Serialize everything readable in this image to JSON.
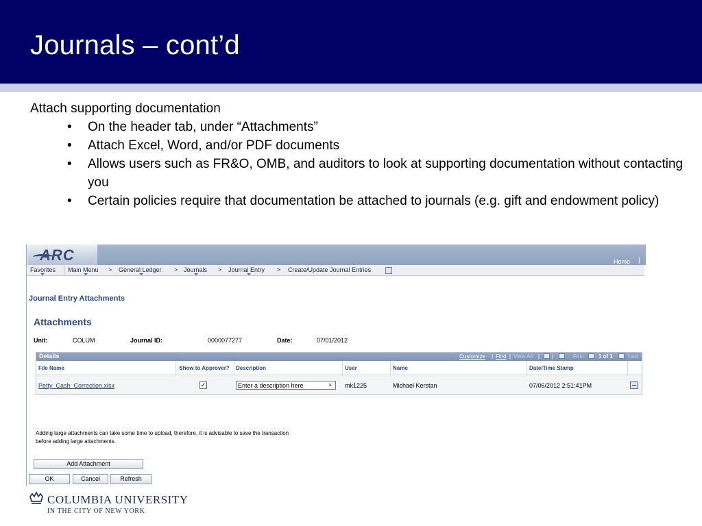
{
  "slide": {
    "title": "Journals – cont’d",
    "intro": "Attach supporting documentation",
    "bullet_char": "•",
    "bullets": [
      "On the header tab, under “Attachments”",
      "Attach Excel, Word, and/or PDF documents",
      "Allows users such as FR&O, OMB, and auditors to look at supporting documentation without contacting you",
      "Certain policies require that documentation be attached to journals (e.g. gift and endowment policy)"
    ]
  },
  "app": {
    "logo": "ARC",
    "home": "Home",
    "home_sep": "|",
    "breadcrumbs": [
      "Favorites",
      "Main Menu",
      "General Ledger",
      "Journals",
      "Journal Entry",
      "Create/Update Journal Entries"
    ],
    "crumb_sep": ">",
    "page_heading": "Journal Entry Attachments",
    "section_heading": "Attachments",
    "info": {
      "unit_label": "Unit:",
      "unit_value": "COLUM",
      "journal_label": "Journal ID:",
      "journal_value": "0000077277",
      "date_label": "Date:",
      "date_value": "07/01/2012"
    },
    "grid": {
      "title": "Details",
      "customize": "Customize",
      "find": "Find",
      "view_all": "View All",
      "sep": "|",
      "first": "First",
      "count": "1 of 1",
      "last": "Last",
      "columns": [
        "File Name",
        "Show to Approver?",
        "Description",
        "User",
        "Name",
        "Date/Time Stamp"
      ],
      "row": {
        "file_name": "Petty_Cash_Correction.xlsx",
        "show_checked": "✓",
        "description": "Enter a description here",
        "clear": "×",
        "user": "mk1225",
        "name": "Michael Kerstan",
        "timestamp": "07/06/2012  2:51:41PM"
      }
    },
    "note_line1": "Adding large attachments can take some time to upload, therefore, it is advisable to save the transaction",
    "note_line2": "before adding large attachments.",
    "buttons": {
      "add": "Add Attachment",
      "ok": "OK",
      "cancel": "Cancel",
      "refresh": "Refresh"
    }
  },
  "logo": {
    "name": "COLUMBIA UNIVERSITY",
    "sub": "IN THE CITY OF NEW YORK"
  },
  "colors": {
    "header_bg": "#000066",
    "header_band": "#c8d2e6",
    "ps_heading": "#27458a",
    "link": "#1f3fa0"
  }
}
